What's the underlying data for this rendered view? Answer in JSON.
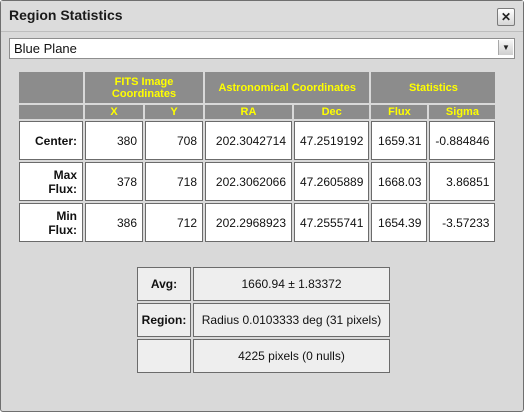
{
  "window": {
    "title": "Region Statistics"
  },
  "plane_select": {
    "selected": "Blue Plane"
  },
  "table": {
    "group_headers": {
      "fits": "FITS Image Coordinates",
      "astro": "Astronomical Coordinates",
      "stats": "Statistics"
    },
    "column_headers": {
      "x": "X",
      "y": "Y",
      "ra": "RA",
      "dec": "Dec",
      "flux": "Flux",
      "sigma": "Sigma"
    },
    "rows": [
      {
        "label": "Center:",
        "x": "380",
        "y": "708",
        "ra": "202.3042714",
        "dec": "47.2519192",
        "flux": "1659.31",
        "sigma": "-0.884846"
      },
      {
        "label": "Max Flux:",
        "x": "378",
        "y": "718",
        "ra": "202.3062066",
        "dec": "47.2605889",
        "flux": "1668.03",
        "sigma": "3.86851"
      },
      {
        "label": "Min Flux:",
        "x": "386",
        "y": "712",
        "ra": "202.2968923",
        "dec": "47.2555741",
        "flux": "1654.39",
        "sigma": "-3.57233"
      }
    ]
  },
  "summary": {
    "avg_label": "Avg:",
    "avg_value": "1660.94 ± 1.83372",
    "region_label": "Region:",
    "region_value": "Radius 0.0103333 deg  (31 pixels)",
    "pixels_value": "4225 pixels (0 nulls)"
  }
}
